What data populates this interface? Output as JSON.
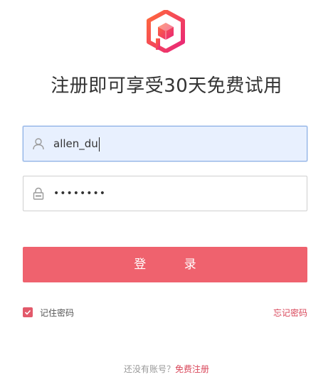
{
  "brand": {
    "logo_icon": "cube-hexagon-logo-icon",
    "colors": {
      "gradient_start": "#ff5e3a",
      "gradient_end": "#e8247a"
    }
  },
  "title": "注册即可享受30天免费试用",
  "username": {
    "value": "allen_du",
    "icon": "user-icon"
  },
  "password": {
    "value": "••••••••",
    "icon": "lock-icon"
  },
  "login_button": {
    "label": "登 录",
    "color": "#ef626e"
  },
  "remember": {
    "label": "记住密码",
    "checked": true
  },
  "forgot_link": "忘记密码",
  "footer": {
    "prompt": "还没有账号？",
    "register_link": "免费注册"
  }
}
